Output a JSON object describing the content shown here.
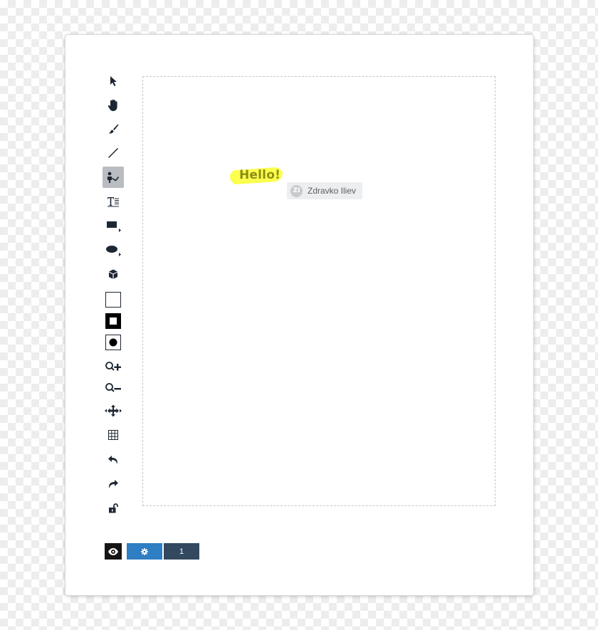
{
  "toolbar": {
    "tools": [
      {
        "name": "select",
        "icon": "arrow-pointer-icon"
      },
      {
        "name": "pan",
        "icon": "hand-icon"
      },
      {
        "name": "brush",
        "icon": "brush-icon"
      },
      {
        "name": "line",
        "icon": "line-icon"
      },
      {
        "name": "presenter",
        "icon": "presenter-icon",
        "active": true
      },
      {
        "name": "text",
        "icon": "text-icon"
      },
      {
        "name": "rectangle",
        "icon": "rectangle-icon"
      },
      {
        "name": "ellipse",
        "icon": "ellipse-icon"
      },
      {
        "name": "shape-3d",
        "icon": "cube-icon"
      },
      {
        "name": "fill-none",
        "icon": "square-outline-icon"
      },
      {
        "name": "fill-stroke",
        "icon": "square-filled-icon"
      },
      {
        "name": "fill-solid",
        "icon": "circle-filled-icon"
      },
      {
        "name": "zoom-in",
        "icon": "zoom-in-icon"
      },
      {
        "name": "zoom-out",
        "icon": "zoom-out-icon"
      },
      {
        "name": "move",
        "icon": "move-arrows-icon"
      },
      {
        "name": "grid",
        "icon": "grid-icon"
      },
      {
        "name": "undo",
        "icon": "undo-icon"
      },
      {
        "name": "redo",
        "icon": "redo-icon"
      },
      {
        "name": "lock",
        "icon": "unlock-icon"
      }
    ]
  },
  "canvas": {
    "highlight_text": "Hello!",
    "highlight_color": "#fbff3f",
    "user": {
      "initials": "ZI",
      "name": "Zdravko Iliev"
    }
  },
  "footer": {
    "eye_icon": "eye-icon",
    "settings_icon": "gear-icon",
    "page_number": "1",
    "settings_color": "#2e7ec3",
    "page_color": "#33495f"
  }
}
